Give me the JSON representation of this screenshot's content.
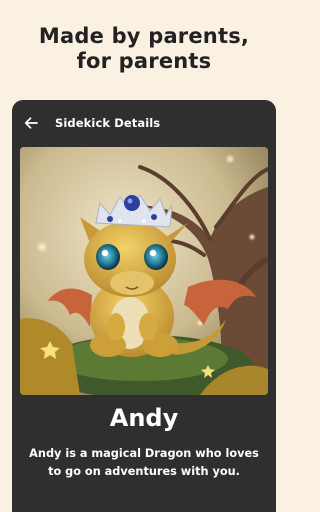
{
  "headline": {
    "line1": "Made by parents,",
    "line2": "for parents"
  },
  "app_bar": {
    "back_icon": "arrow-left-icon",
    "title": "Sidekick Details"
  },
  "sidekick": {
    "name": "Andy",
    "description": "Andy is a magical Dragon who loves to go on adventures with you."
  },
  "colors": {
    "page_background": "#fbf1e2",
    "panel_background": "#2f2f2f",
    "text_on_panel": "#ffffff",
    "headline_text": "#222222",
    "dragon_gold": "#dcae3e",
    "crown_jewel": "#2b3f9e"
  }
}
